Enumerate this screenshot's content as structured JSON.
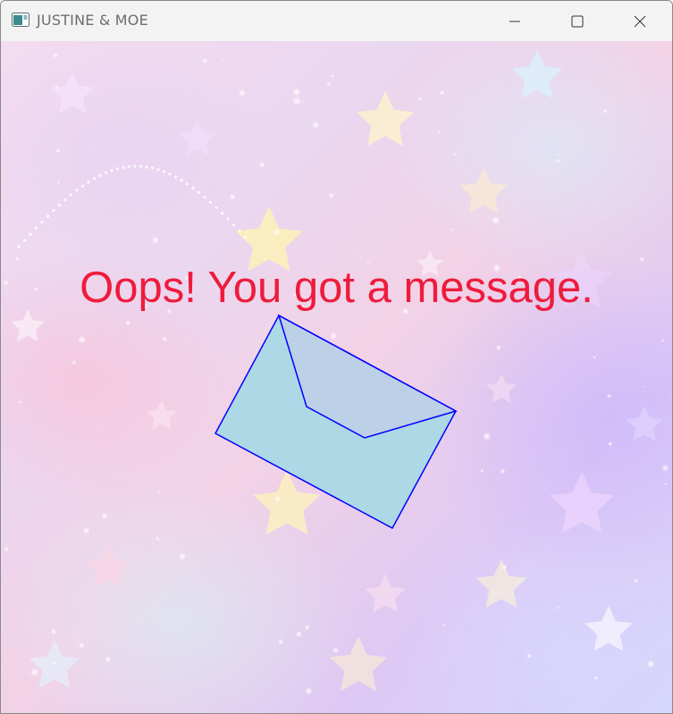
{
  "window": {
    "title": "JUSTINE & MOE",
    "icon": "app-window-icon",
    "controls": {
      "minimize_icon": "minimize-icon",
      "maximize_icon": "maximize-icon",
      "close_icon": "close-icon"
    }
  },
  "content": {
    "message": "Oops! You got a message.",
    "message_color": "#ee1c3c",
    "envelope": {
      "icon": "envelope-icon",
      "fill_color": "#add8e6",
      "stroke_color": "#0000ff"
    }
  }
}
